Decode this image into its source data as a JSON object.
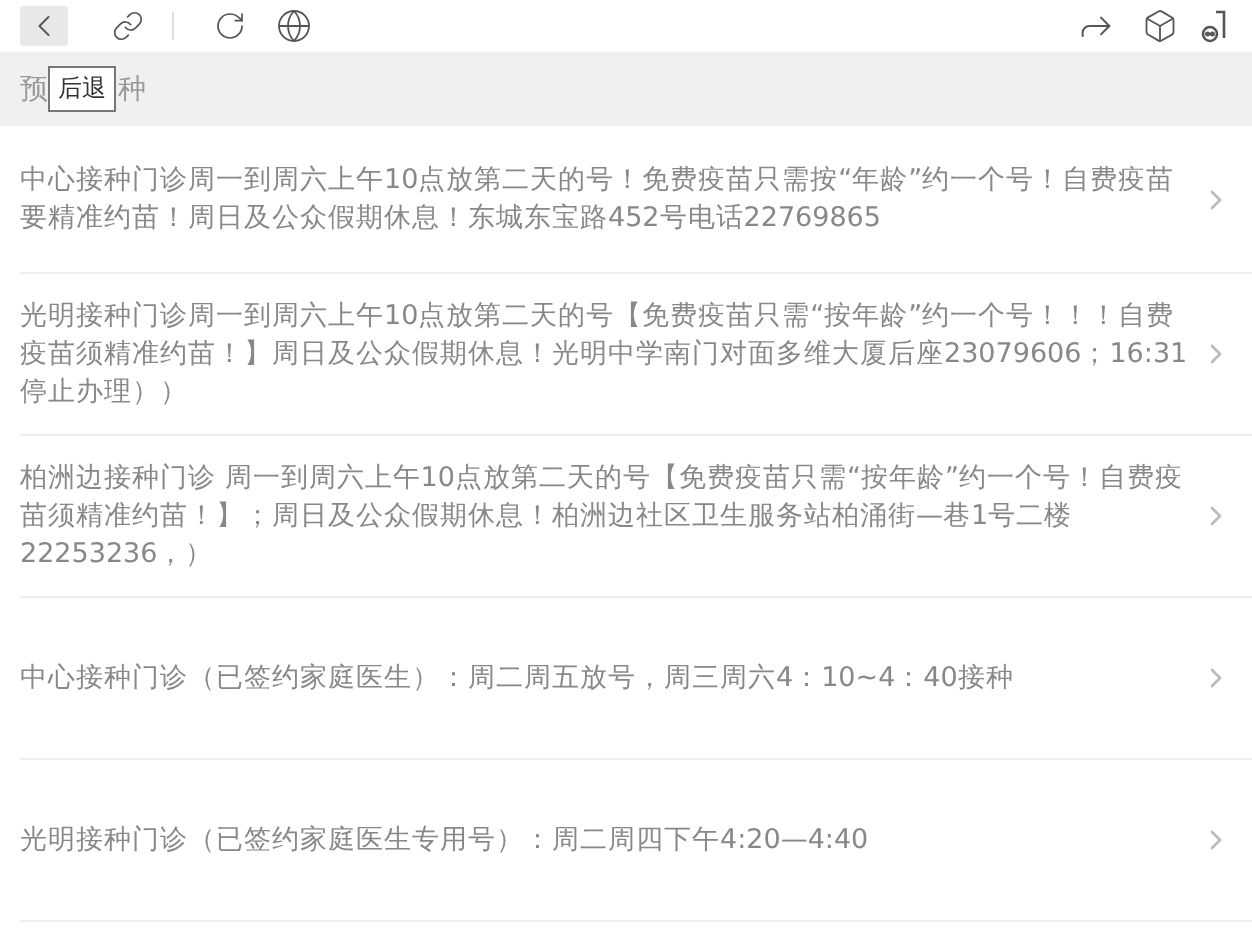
{
  "toolbar": {
    "tooltip": "后退"
  },
  "header": {
    "title_start": "预",
    "title_end": "种"
  },
  "items": [
    {
      "text": "中心接种门诊周一到周六上午10点放第二天的号！免费疫苗只需按“年龄”约一个号！自费疫苗要精准约苗！周日及公众假期休息！东城东宝路452号电话22769865"
    },
    {
      "text": "光明接种门诊周一到周六上午10点放第二天的号【免费疫苗只需“按年龄”约一个号！！！自费疫苗须精准约苗！】周日及公众假期休息！光明中学南门对面多维大厦后座23079606；16:31停止办理））"
    },
    {
      "text": "柏洲边接种门诊 周一到周六上午10点放第二天的号【免费疫苗只需“按年龄”约一个号！自费疫苗须精准约苗！】；周日及公众假期休息！柏洲边社区卫生服务站柏涌街—巷1号二楼22253236，）"
    },
    {
      "text": "中心接种门诊（已签约家庭医生）：周二周五放号，周三周六4：10~4：40接种"
    },
    {
      "text": "光明接种门诊（已签约家庭医生专用号）：周二周四下午4:20—4:40"
    }
  ]
}
